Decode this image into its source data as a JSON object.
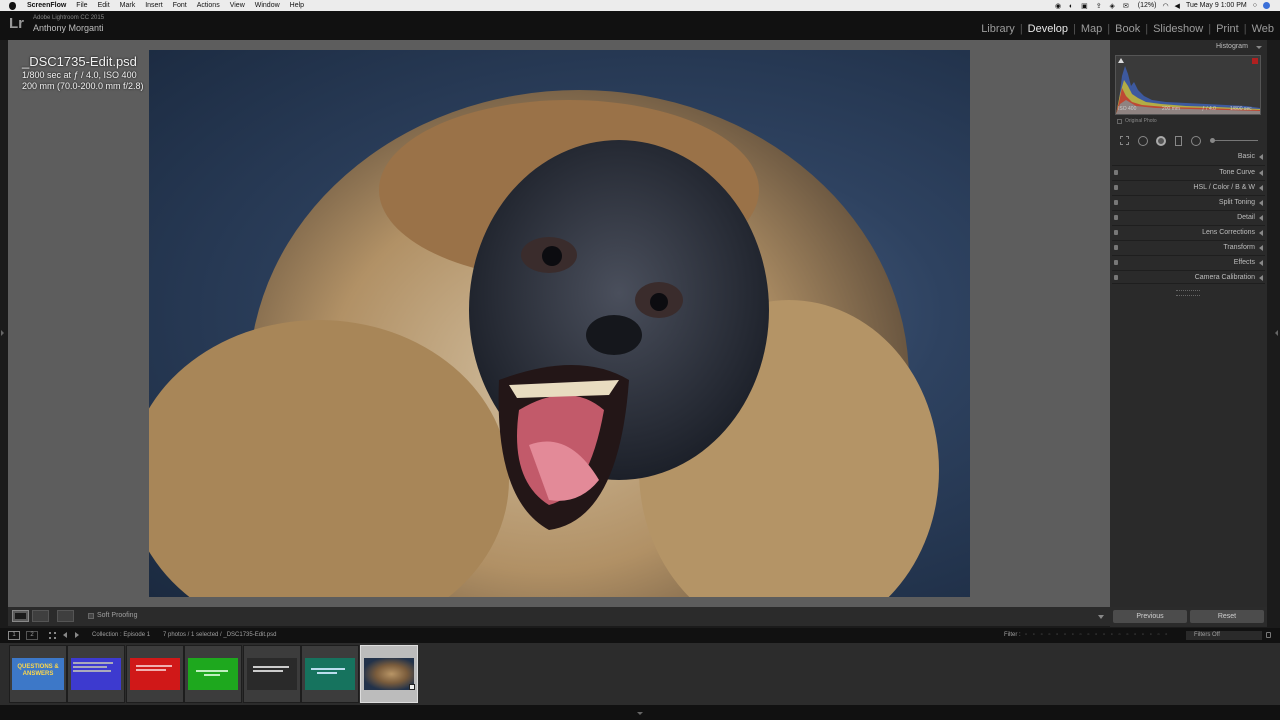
{
  "menubar": {
    "app_name": "ScreenFlow",
    "items": [
      "File",
      "Edit",
      "Mark",
      "Insert",
      "Font",
      "Actions",
      "View",
      "Window",
      "Help"
    ],
    "battery": "(12%)",
    "datetime": "Tue May 9  1:00 PM"
  },
  "lr": {
    "logo": "Lr",
    "version": "Adobe Lightroom CC 2015",
    "user": "Anthony Morganti",
    "modules": [
      "Library",
      "Develop",
      "Map",
      "Book",
      "Slideshow",
      "Print",
      "Web"
    ],
    "active_module": "Develop"
  },
  "photo_info": {
    "filename": "_DSC1735-Edit.psd",
    "exposure": "1/800 sec at ƒ / 4.0, ISO 400",
    "lens": "200 mm (70.0-200.0 mm f/2.8)"
  },
  "histogram": {
    "title": "Histogram",
    "iso": "ISO 400",
    "focal": "200 mm",
    "aperture": "ƒ / 4.0",
    "shutter": "1/800 sec",
    "original_photo_label": "Original Photo"
  },
  "panels": [
    "Basic",
    "Tone Curve",
    "HSL  /  Color  /  B & W",
    "Split Toning",
    "Detail",
    "Lens Corrections",
    "Transform",
    "Effects",
    "Camera Calibration"
  ],
  "view_toolbar": {
    "soft_proofing": "Soft Proofing"
  },
  "buttons": {
    "previous": "Previous",
    "reset": "Reset"
  },
  "filmstrip_bar": {
    "pages": [
      "1",
      "2"
    ],
    "collection": "Collection : Episode 1",
    "selection": "7 photos / 1 selected / _DSC1735-Edit.psd",
    "filter_label": "Filter :",
    "filter_value": "Filters Off"
  },
  "thumbnails": [
    {
      "caption": "QUESTIONS & ANSWERS",
      "bg": "#3d78c8"
    },
    {
      "caption": "",
      "bg": "#3d3acf"
    },
    {
      "caption": "",
      "bg": "#d01818"
    },
    {
      "caption": "",
      "bg": "#1ea81e"
    },
    {
      "caption": "",
      "bg": "#3a3a3a"
    },
    {
      "caption": "",
      "bg": "#16735e"
    },
    {
      "caption": "",
      "bg": "#2a3a52"
    }
  ]
}
